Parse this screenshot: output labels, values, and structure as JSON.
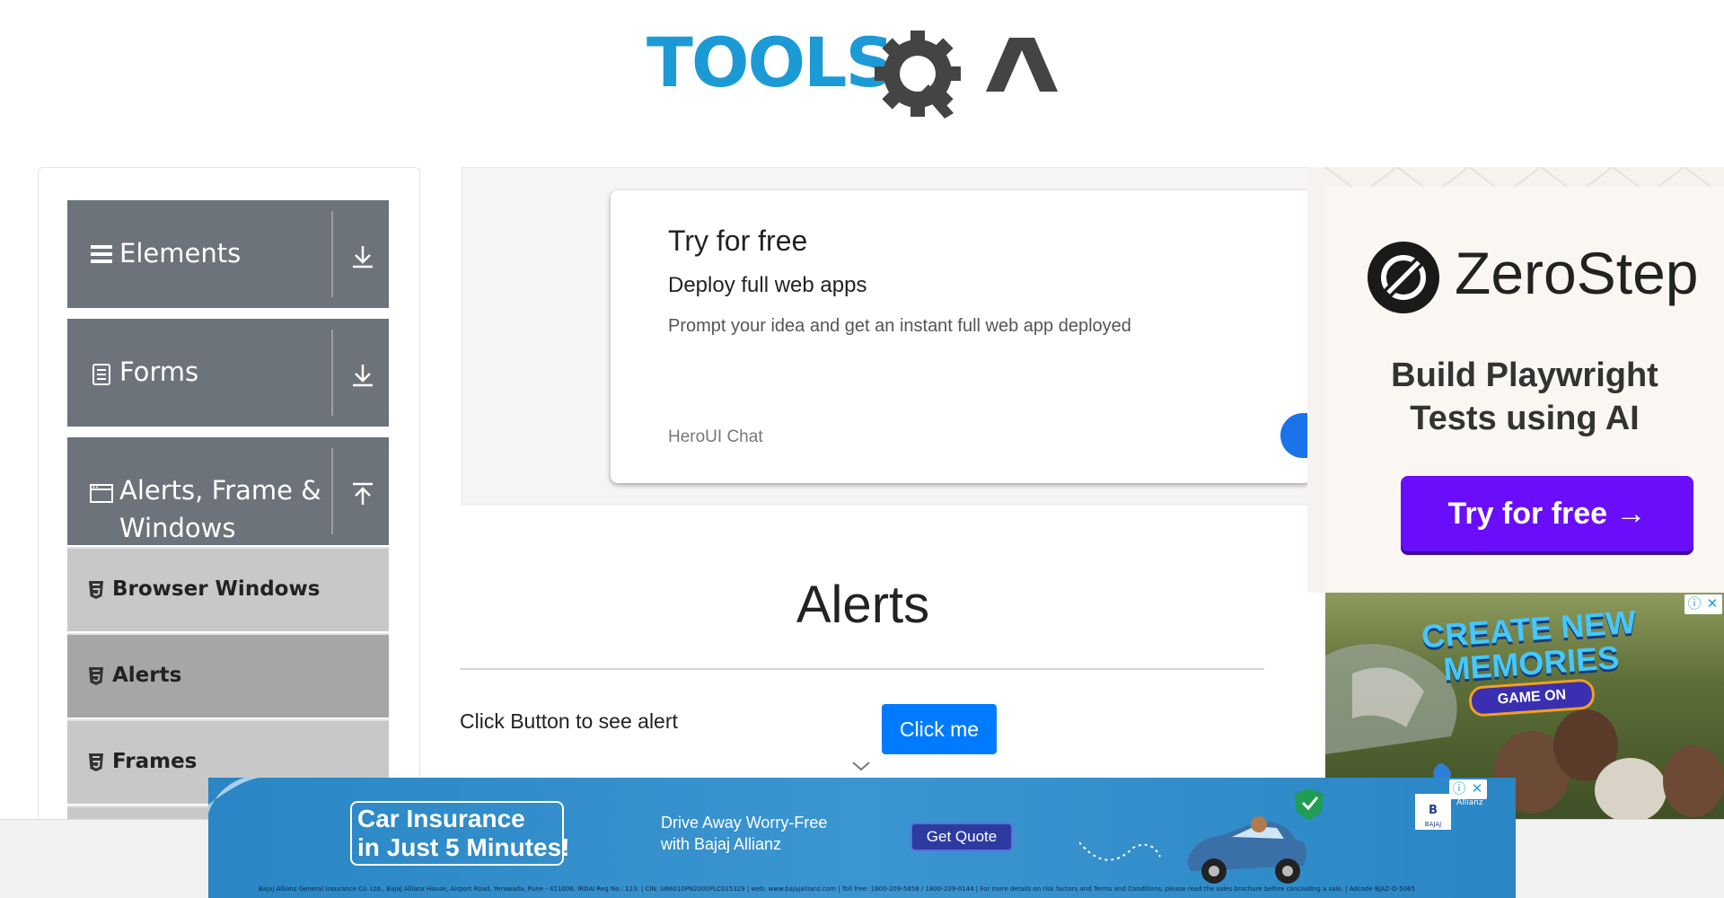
{
  "header": {
    "logo_text_blue": "TOOLS",
    "logo_text_dark": "QA"
  },
  "sidebar": {
    "groups": [
      {
        "label": "Elements",
        "icon": "hamburger-icon",
        "toggle": "download-arrow-icon"
      },
      {
        "label": "Forms",
        "icon": "form-document-icon",
        "toggle": "download-arrow-icon"
      },
      {
        "label_line1": "Alerts, Frame &",
        "label_line2": "Windows",
        "icon": "browser-window-icon",
        "toggle": "upload-arrow-icon"
      }
    ],
    "items": [
      {
        "label": "Browser Windows",
        "active": false
      },
      {
        "label": "Alerts",
        "active": true
      },
      {
        "label": "Frames",
        "active": false
      }
    ]
  },
  "ad_card": {
    "title": "Try for free",
    "subtitle": "Deploy full web apps",
    "description": "Prompt your idea and get an instant full web app deployed",
    "brand": "HeroUI Chat"
  },
  "ad_zerostep": {
    "name": "ZeroStep",
    "headline_line1": "Build Playwright",
    "headline_line2": "Tests using AI",
    "button": "Try for free →",
    "accent": "#6a0dfa"
  },
  "ad_game": {
    "headline_line1": "CREATE NEW",
    "headline_line2": "MEMORIES",
    "button": "GAME ON"
  },
  "main": {
    "heading": "Alerts",
    "row_label": "Click Button to see alert",
    "button": "Click me",
    "button_color": "#007bff"
  },
  "ad_bottom": {
    "headline_line1": "Car Insurance",
    "headline_line2": "in Just 5 Minutes!",
    "tagline_line1": "Drive Away Worry-Free",
    "tagline_line2": "with Bajaj Allianz",
    "button": "Get Quote",
    "brand": "BAJAJ",
    "brand_partner": "Allianz",
    "legal": "Bajaj Allianz General Insurance Co. Ltd., Bajaj Allianz House, Airport Road, Yerawada, Pune - 411006. IRDAI Reg No.: 113. | CIN: U66010PN2000PLC015329 | web: www.bajajallianz.com | Toll free: 1800-209-5858 / 1800-209-0144 | For more details on risk factors and Terms and Conditions, please read the sales brochure before concluding a sale. | Adcode BJAZ-O-5065"
  }
}
